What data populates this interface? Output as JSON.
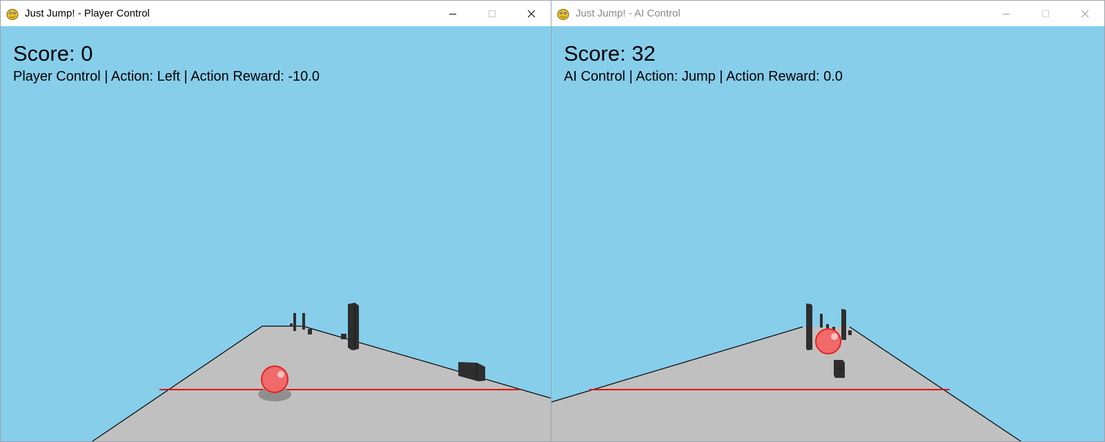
{
  "windows": {
    "player": {
      "title": "Just Jump! - Player Control",
      "score_text": "Score: 0",
      "status_text": "Player Control | Action: Left | Action Reward: -10.0",
      "score": 0,
      "mode": "Player Control",
      "action": "Left",
      "action_reward": -10.0,
      "active": true
    },
    "ai": {
      "title": "Just Jump! - AI Control",
      "score_text": "Score: 32",
      "status_text": "AI Control | Action: Jump | Action Reward: 0.0",
      "score": 32,
      "mode": "AI Control",
      "action": "Jump",
      "action_reward": 0.0,
      "active": false
    }
  },
  "icons": {
    "app": "pygame-snake-icon",
    "minimize": "minimize-icon",
    "maximize": "maximize-icon",
    "close": "close-icon"
  },
  "colors": {
    "sky": "#87ceeb",
    "ground": "#c0c0c0",
    "ground_edge": "#000000",
    "line": "#e01010",
    "ball": "#f06a6a",
    "obstacle": "#2e2e2e",
    "shadow": "#8f8f8f"
  }
}
